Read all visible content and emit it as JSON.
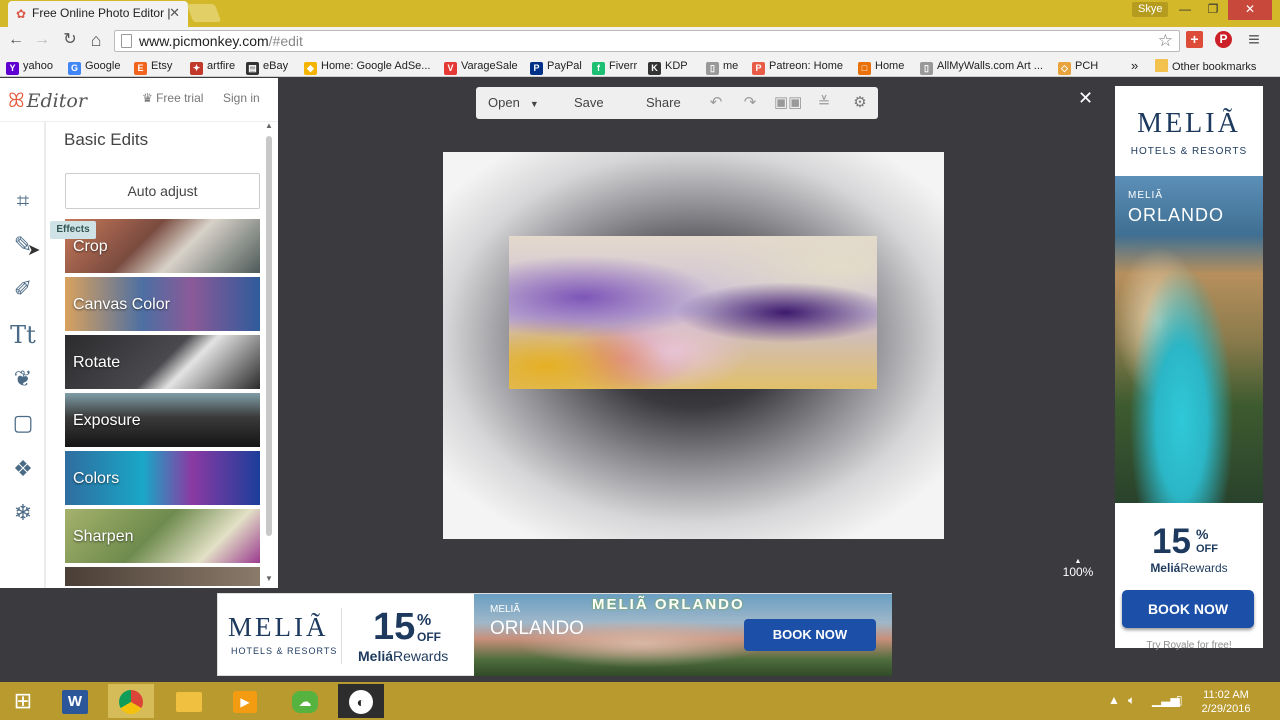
{
  "browser": {
    "tab_title": "Free Online Photo Editor | ",
    "tab_close": "✕",
    "user": "Skye",
    "minimize": "—",
    "maximize": "❐",
    "close": "✕",
    "url_host": "www.picmonkey.com",
    "url_path": "/#edit",
    "nav": {
      "back": "←",
      "forward": "→",
      "reload": "↻",
      "home": "⌂",
      "star": "☆",
      "menu": "≡",
      "more": "»"
    }
  },
  "bookmarks": [
    {
      "label": "yahoo",
      "icon": "Y",
      "color": "#5f01d1"
    },
    {
      "label": "Google",
      "icon": "G",
      "color": "#4285f4"
    },
    {
      "label": "Etsy",
      "icon": "E",
      "color": "#f1641e"
    },
    {
      "label": "artfire",
      "icon": "✦",
      "color": "#c0392b"
    },
    {
      "label": "eBay",
      "icon": "▤",
      "color": "#333333"
    },
    {
      "label": "Home: Google AdSe...",
      "icon": "◆",
      "color": "#f4b400"
    },
    {
      "label": "VarageSale",
      "icon": "V",
      "color": "#e53935"
    },
    {
      "label": "PayPal",
      "icon": "P",
      "color": "#003087"
    },
    {
      "label": "Fiverr",
      "icon": "f",
      "color": "#1dbf73"
    },
    {
      "label": "KDP",
      "icon": "K",
      "color": "#333333"
    },
    {
      "label": "me",
      "icon": "▯",
      "color": "#999999"
    },
    {
      "label": "Patreon: Home",
      "icon": "P",
      "color": "#e85b46"
    },
    {
      "label": "Home",
      "icon": "□",
      "color": "#e8710a"
    },
    {
      "label": "AllMyWalls.com Art ...",
      "icon": "▯",
      "color": "#999999"
    },
    {
      "label": "PCH",
      "icon": "◇",
      "color": "#e8a33d"
    }
  ],
  "other_bookmarks": "Other bookmarks",
  "editor": {
    "logo": "Editor",
    "free_trial": "Free trial",
    "sign_in": "Sign in",
    "panel_title": "Basic Edits",
    "auto_adjust": "Auto adjust",
    "tooltip": "Effects",
    "tiles": [
      {
        "label": "Crop",
        "bg": "linear-gradient(135deg,#c9795a 0%,#7a4b3f 40%,#d8d2c9 60%,#4c5a58 100%)"
      },
      {
        "label": "Canvas Color",
        "bg": "linear-gradient(90deg,#d9a25e 0%,#4d6fa3 40%,#8b5a98 65%,#2f5b9b 100%)"
      },
      {
        "label": "Rotate",
        "bg": "linear-gradient(135deg,#2b2b2e 0%,#4a4a4e 50%,#e3e3e3 62%,#2a2a2a 100%)"
      },
      {
        "label": "Exposure",
        "bg": "linear-gradient(180deg,#7f9ea8 0%,#3a3a3a 45%,#151515 100%)"
      },
      {
        "label": "Colors",
        "bg": "linear-gradient(90deg,#2f6d9f 0%,#19a7c7 40%,#8b3aa3 65%,#1b3e9a 100%)"
      },
      {
        "label": "Sharpen",
        "bg": "linear-gradient(135deg,#a5b26c 0%,#6e8b4d 45%,#e3e0c6 75%,#9a3a8e 100%)"
      }
    ]
  },
  "canvas_toolbar": {
    "open": "Open",
    "save": "Save",
    "share": "Share",
    "close": "✕",
    "zoom": "100%"
  },
  "ad_right": {
    "brand": "MELIÃ",
    "sub": "HOTELS & RESORTS",
    "city_small": "MELIÃ",
    "city": "ORLANDO",
    "pct_num": "15",
    "pct_sign": "%",
    "off": "OFF",
    "rewards_bold": "Meliá",
    "rewards": "Rewards",
    "cta": "BOOK NOW",
    "footer": "Try Royale for free!"
  },
  "ad_bottom": {
    "brand": "MELIÃ",
    "sub": "HOTELS & RESORTS",
    "pct_num": "15",
    "pct_sign": "%",
    "off": "OFF",
    "rewards_bold": "Meliá",
    "rewards": "Rewards",
    "city_small": "MELIÃ",
    "city": "ORLANDO",
    "sign": "MELIÃ ORLANDO",
    "cta": "BOOK NOW"
  },
  "taskbar": {
    "time": "11:02 AM",
    "date": "2/29/2016"
  }
}
